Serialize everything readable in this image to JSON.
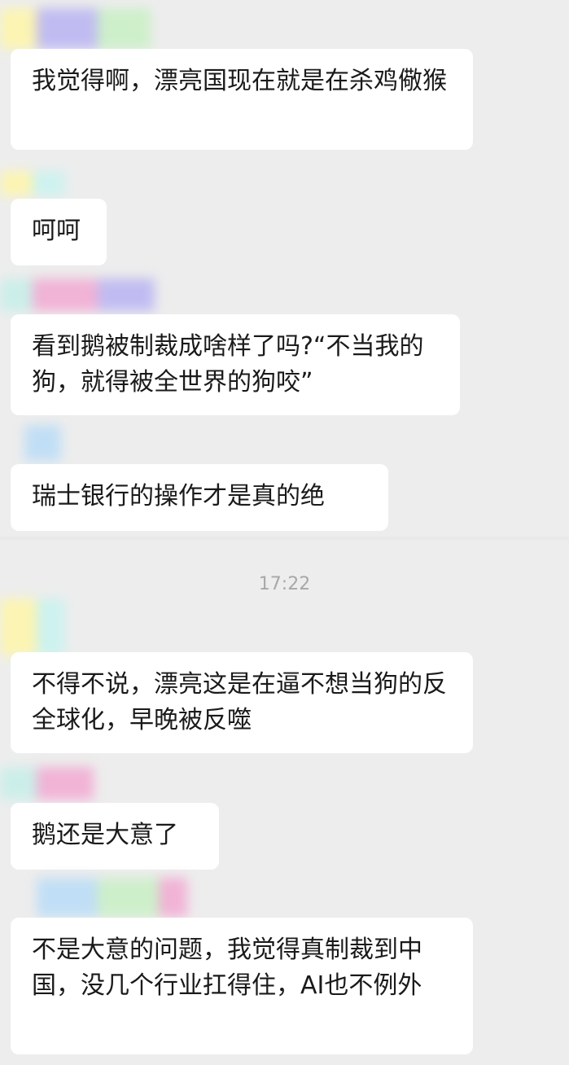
{
  "messages": [
    {
      "text": "我觉得啊，漂亮国现在就是在杀鸡儆猴"
    },
    {
      "text": "呵呵"
    },
    {
      "text": "看到鹅被制裁成啥样了吗?“不当我的狗，就得被全世界的狗咬”"
    },
    {
      "text": "瑞士银行的操作才是真的绝"
    },
    {
      "text": "不得不说，漂亮这是在逼不想当狗的反全球化，早晚被反噬"
    },
    {
      "text": "鹅还是大意了"
    },
    {
      "text": "不是大意的问题，我觉得真制裁到中国，没几个行业扛得住，AI也不例外"
    }
  ],
  "timestamp": "17:22",
  "colors": {
    "background": "#ededed",
    "bubble": "#ffffff",
    "text": "#1a1a1a",
    "timestamp": "#a8a8a8"
  }
}
